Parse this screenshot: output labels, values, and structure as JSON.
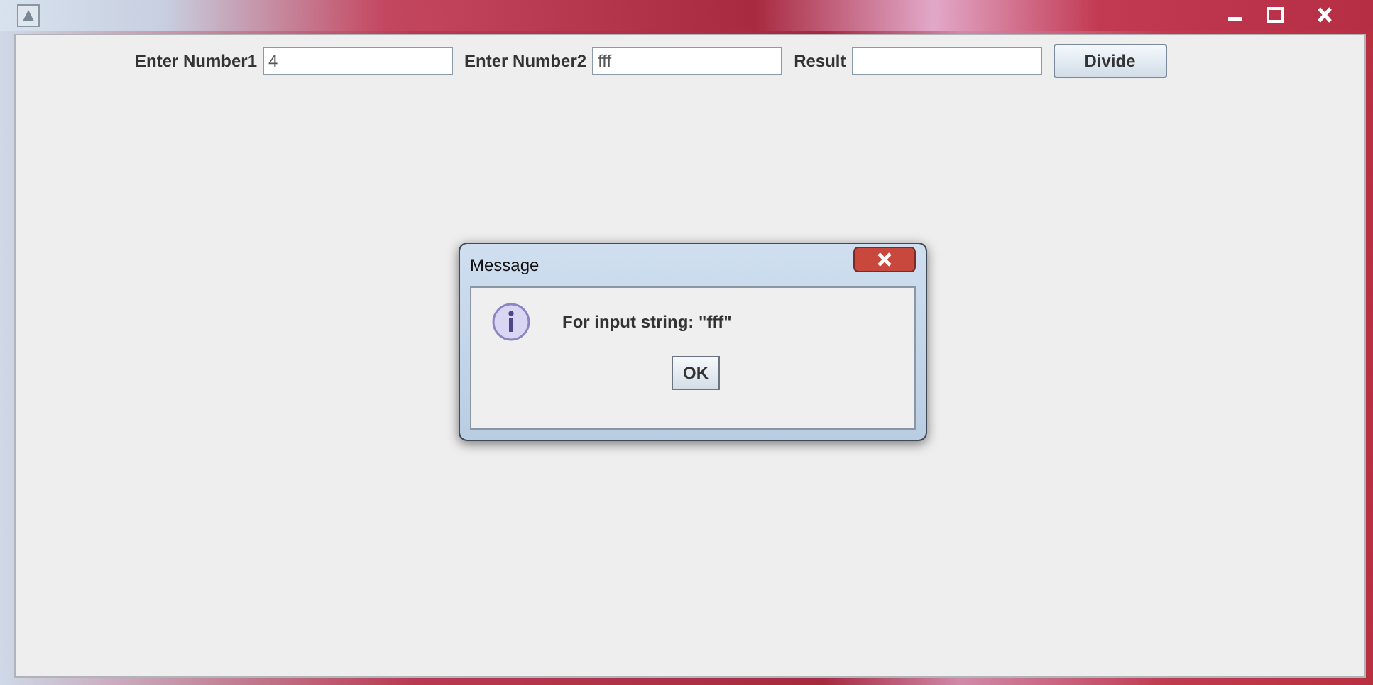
{
  "form": {
    "fields": [
      {
        "label": "Enter Number1",
        "value": "4"
      },
      {
        "label": "Enter Number2",
        "value": "fff"
      },
      {
        "label": "Result"
      }
    ],
    "button": "Divide"
  },
  "dialog": {
    "title": "Message",
    "message": "For input string: \"fff\"",
    "button": "OK"
  }
}
